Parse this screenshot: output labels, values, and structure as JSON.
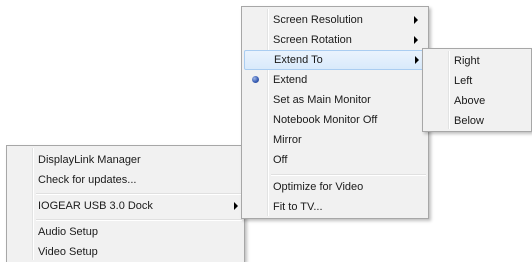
{
  "main_menu": {
    "items": [
      {
        "label": "Screen Resolution",
        "submenu": true
      },
      {
        "label": "Screen Rotation",
        "submenu": true
      },
      {
        "label": "Extend To",
        "submenu": true,
        "highlighted": true
      },
      {
        "label": "Extend",
        "selected": true
      },
      {
        "label": "Set as Main Monitor"
      },
      {
        "label": "Notebook Monitor Off"
      },
      {
        "label": "Mirror"
      },
      {
        "label": "Off"
      },
      {
        "label": "Optimize for Video"
      },
      {
        "label": "Fit to TV..."
      }
    ]
  },
  "extend_to_submenu": {
    "items": [
      {
        "label": "Right"
      },
      {
        "label": "Left"
      },
      {
        "label": "Above"
      },
      {
        "label": "Below"
      }
    ]
  },
  "tray_menu": {
    "items": [
      {
        "label": "DisplayLink Manager"
      },
      {
        "label": "Check for updates..."
      },
      {
        "label": "IOGEAR USB 3.0 Dock",
        "submenu": true
      },
      {
        "label": "Audio Setup"
      },
      {
        "label": "Video Setup"
      }
    ]
  },
  "colors": {
    "menu_background": "#f1f1f1",
    "menu_border": "#a7a7a7",
    "highlight_background": "#d9eafb",
    "highlight_border": "#aacdf1",
    "radio_bullet": "#3a5fb5"
  },
  "icons": {
    "submenu_indicator": "chevron-right-icon",
    "selected_indicator": "radio-bullet-icon"
  }
}
